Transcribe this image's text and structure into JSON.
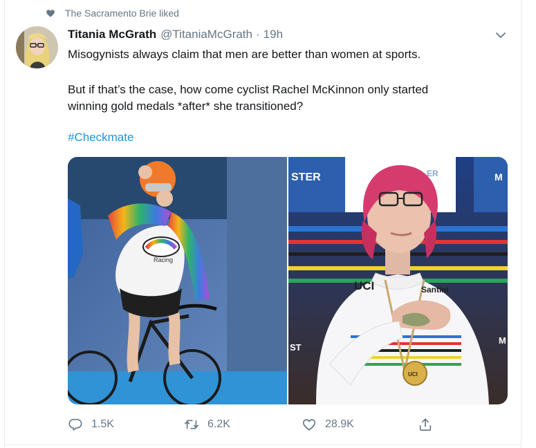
{
  "context": {
    "label": "The Sacramento Brie liked",
    "icon": "heart-icon"
  },
  "tweet": {
    "author_name": "Titania McGrath",
    "author_handle": "@TitaniaMcGrath",
    "separator": "·",
    "time": "19h",
    "lines": [
      "Misogynists always claim that men are better than women at sports.",
      "But if that’s the case, how come cyclist Rachel McKinnon only started",
      "winning gold medals *after* she transitioned?"
    ],
    "hashtag": "#Checkmate"
  },
  "photos": {
    "left": {
      "jersey_text": "Racing"
    },
    "right": {
      "banner_text": "STER",
      "banner_text_2": "ER",
      "banner_text_3": "M",
      "jersey_brand": "UCI",
      "jersey_sponsor": "Santini",
      "medal_text": "UCI",
      "side_text": "ST",
      "side_text_2": "M"
    }
  },
  "actions": {
    "reply_count": "1.5K",
    "retweet_count": "6.2K",
    "like_count": "28.9K"
  },
  "colors": {
    "accent": "#1b95e0",
    "muted": "#657786",
    "text": "#14171a"
  }
}
